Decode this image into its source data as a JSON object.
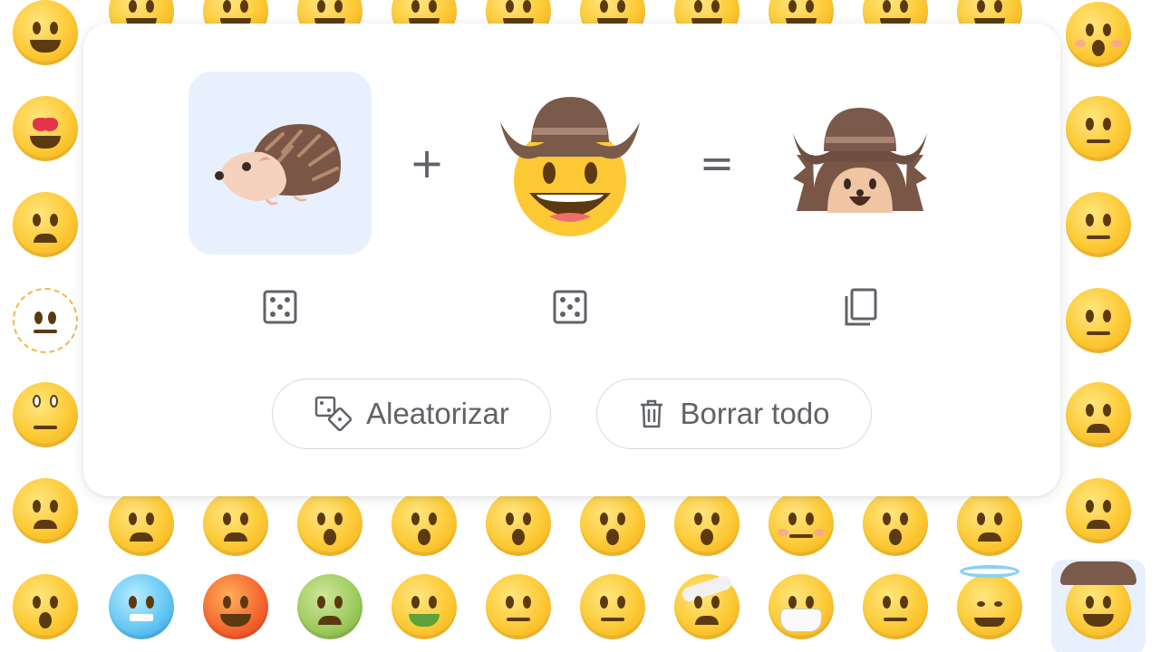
{
  "kitchen": {
    "plus": "+",
    "equals": "=",
    "left_emoji": "hedgehog-icon",
    "middle_emoji": "cowboy-hat-face-icon",
    "result_emoji": "hedgehog-cowboy-mashup-icon",
    "left_action": "dice-icon",
    "middle_action": "dice-icon",
    "result_action": "copy-icon",
    "randomize_label": "Aleatorizar",
    "clear_label": "Borrar todo"
  },
  "colors": {
    "selected_bg": "#e8f0fe",
    "emoji_yellow": "#fcc934",
    "button_text": "#5f6368",
    "button_border": "#d6d9dc"
  }
}
